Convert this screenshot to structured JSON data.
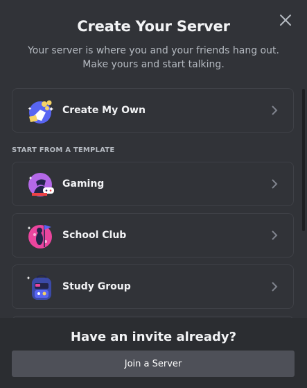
{
  "modal": {
    "title": "Create Your Server",
    "subtitle": "Your server is where you and your friends hang out. Make yours and start talking.",
    "close_icon": "close-icon"
  },
  "options": {
    "create_own": {
      "label": "Create My Own",
      "icon": "create-server-icon"
    },
    "section_label": "START FROM A TEMPLATE",
    "templates": [
      {
        "label": "Gaming",
        "icon": "gaming-icon"
      },
      {
        "label": "School Club",
        "icon": "school-club-icon"
      },
      {
        "label": "Study Group",
        "icon": "study-group-icon"
      }
    ]
  },
  "footer": {
    "title": "Have an invite already?",
    "join_label": "Join a Server"
  },
  "colors": {
    "background": "#313338",
    "footer_bg": "#2b2d31",
    "card_border": "#3f4147",
    "button_bg": "#4e5058",
    "text_primary": "#f2f3f5",
    "text_secondary": "#b5bac1"
  }
}
